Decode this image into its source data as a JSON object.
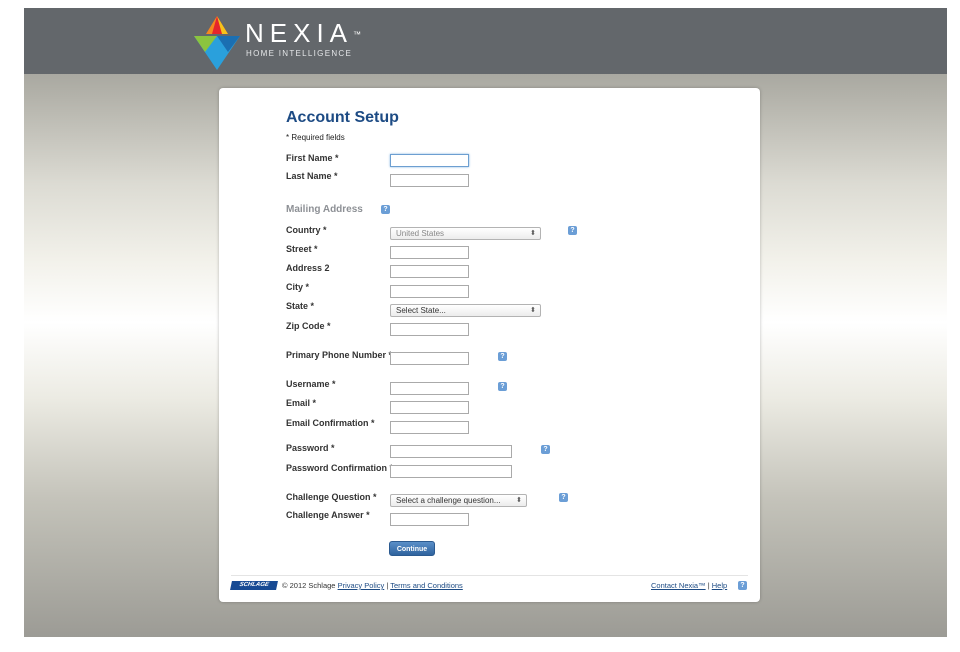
{
  "brand": {
    "name": "NEXIA",
    "trademark": "™",
    "tagline": "HOME INTELLIGENCE",
    "logo_icon": "nexia-triangle-logo-icon",
    "colors": {
      "header_bg": "#63676b",
      "accent_blue": "#1d4b84",
      "help_blue": "#6b9ed6"
    }
  },
  "form": {
    "title": "Account Setup",
    "required_note": "* Required fields",
    "first_name_label": "First Name *",
    "last_name_label": "Last Name *",
    "mailing_section": "Mailing Address",
    "country_label": "Country *",
    "country_value": "United States",
    "street_label": "Street *",
    "address2_label": "Address 2",
    "city_label": "City *",
    "state_label": "State *",
    "state_value": "Select State...",
    "zip_label": "Zip Code *",
    "phone_label": "Primary Phone Number *",
    "username_label": "Username *",
    "email_label": "Email *",
    "email_confirm_label": "Email Confirmation *",
    "password_label": "Password *",
    "password_confirm_label": "Password Confirmation *",
    "challenge_question_label": "Challenge Question *",
    "challenge_question_value": "Select a challenge question...",
    "challenge_answer_label": "Challenge Answer *",
    "help_glyph": "?",
    "select_arrow": "⬍",
    "continue_label": "Continue"
  },
  "footer": {
    "schlage_logo": "SCHLAGE",
    "copyright": "© 2012 Schlage",
    "privacy_link": "Privacy Policy",
    "separator": "|",
    "terms_link": "Terms and Conditions",
    "contact_link": "Contact Nexia™",
    "help_link": "Help"
  }
}
